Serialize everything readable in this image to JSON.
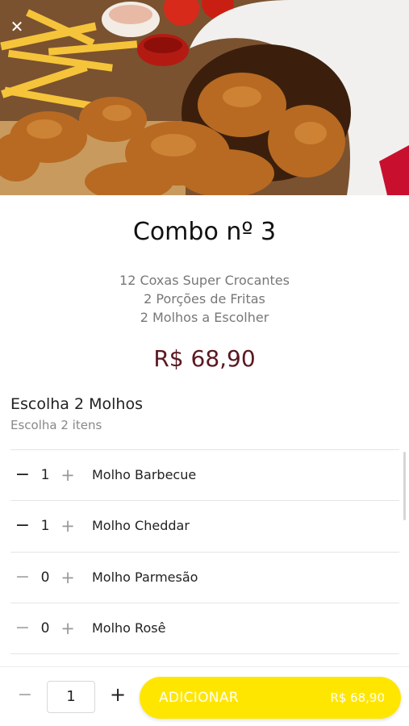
{
  "header": {
    "close_icon": "close-icon"
  },
  "product": {
    "title": "Combo nº 3",
    "description": [
      "12 Coxas Super Crocantes",
      "2 Porções de Fritas",
      "2 Molhos  a Escolher"
    ],
    "price": "R$ 68,90"
  },
  "group": {
    "title": "Escolha 2 Molhos",
    "subtitle": "Escolha 2 itens",
    "options": [
      {
        "label": "Molho Barbecue",
        "qty": "1",
        "minus": "−",
        "plus": "+"
      },
      {
        "label": "Molho Cheddar",
        "qty": "1",
        "minus": "−",
        "plus": "+"
      },
      {
        "label": "Molho Parmesão",
        "qty": "0",
        "minus": "−",
        "plus": "+"
      },
      {
        "label": "Molho Rosê",
        "qty": "0",
        "minus": "−",
        "plus": "+"
      }
    ]
  },
  "footer": {
    "minus": "−",
    "quantity": "1",
    "plus": "+",
    "add_label": "ADICIONAR",
    "add_price": "R$ 68,90"
  },
  "colors": {
    "accent": "#ffe600",
    "price": "#5a1820"
  }
}
